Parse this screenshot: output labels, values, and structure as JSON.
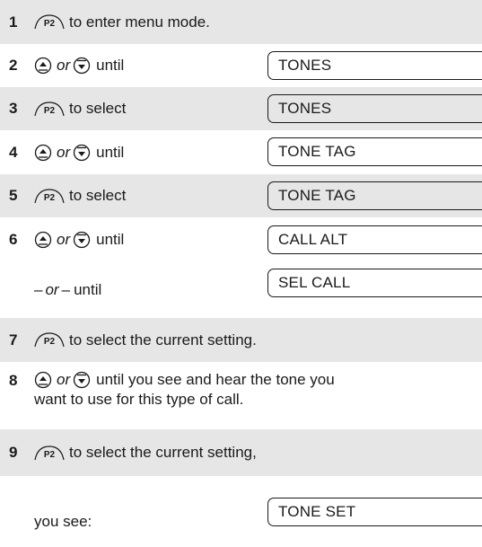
{
  "steps": [
    {
      "num": "1",
      "text": "to enter menu mode."
    },
    {
      "num": "2",
      "or": "or",
      "text": "until",
      "display": "TONES"
    },
    {
      "num": "3",
      "text": "to select",
      "display": "TONES"
    },
    {
      "num": "4",
      "or": "or",
      "text": "until",
      "display": "TONE TAG"
    },
    {
      "num": "5",
      "text": "to select",
      "display": "TONE TAG"
    },
    {
      "num": "6",
      "or": "or",
      "text": "until",
      "display": "CALL ALT"
    },
    {
      "alt_dash1": "–",
      "alt_or": "or",
      "alt_dash2": "–",
      "text": "until",
      "display": "SEL CALL"
    },
    {
      "num": "7",
      "text": "to select the current setting."
    },
    {
      "num": "8",
      "or": "or",
      "text_line1": "until you see and hear the tone you",
      "text_line2": "want to use for this type of call."
    },
    {
      "num": "9",
      "text": "to select the current setting,"
    },
    {
      "text": "you see:",
      "display": "TONE SET"
    }
  ],
  "key_label": "P2",
  "icons": {
    "p2": "p2-key-icon",
    "up": "up-arrow-key-icon",
    "down": "down-arrow-key-icon"
  },
  "colors": {
    "shade": "#e6e6e6",
    "ink": "#1a1a1a"
  }
}
